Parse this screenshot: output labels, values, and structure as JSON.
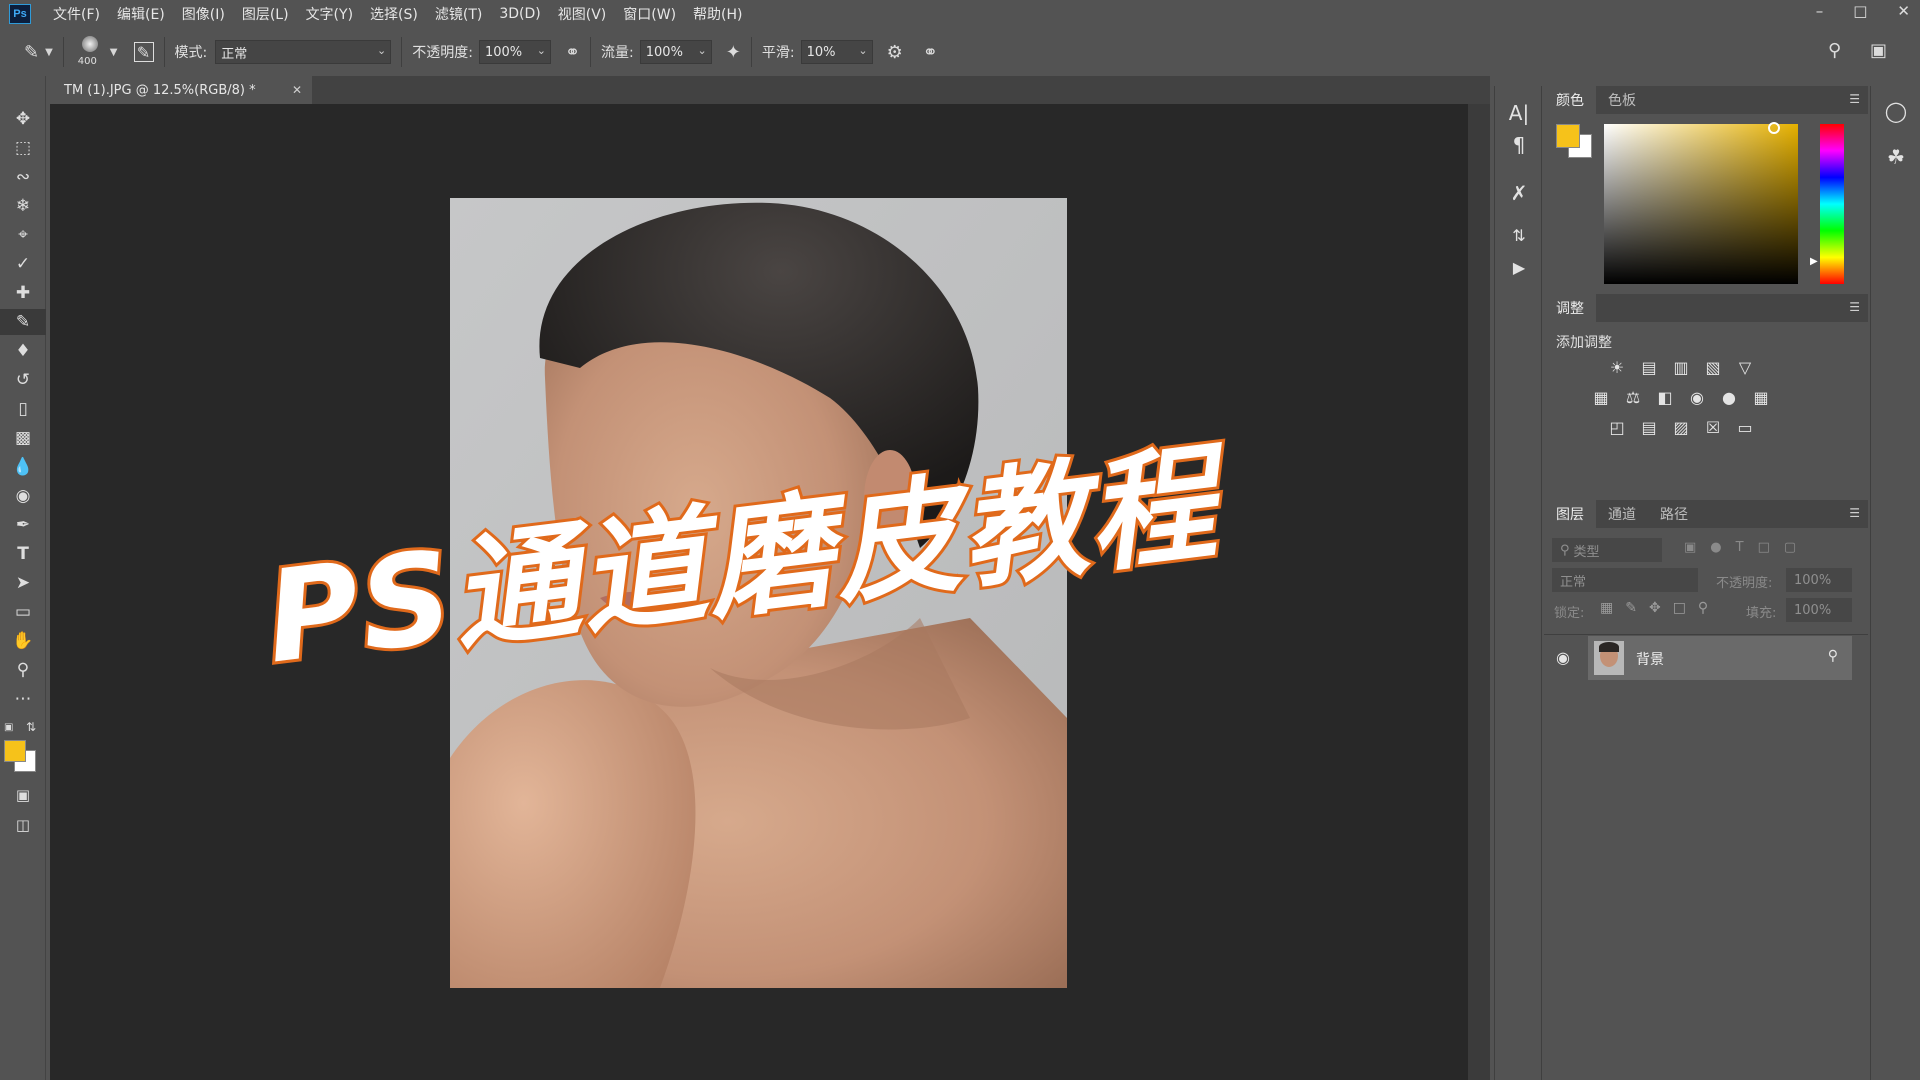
{
  "app": {
    "logo": "Ps"
  },
  "menu": [
    "文件(F)",
    "编辑(E)",
    "图像(I)",
    "图层(L)",
    "文字(Y)",
    "选择(S)",
    "滤镜(T)",
    "3D(D)",
    "视图(V)",
    "窗口(W)",
    "帮助(H)"
  ],
  "options": {
    "brush_size": "400",
    "mode_label": "模式:",
    "mode_value": "正常",
    "opacity_label": "不透明度:",
    "opacity_value": "100%",
    "flow_label": "流量:",
    "flow_value": "100%",
    "smooth_label": "平滑:",
    "smooth_value": "10%"
  },
  "document": {
    "tab_title": "TM (1).JPG @ 12.5%(RGB/8) *"
  },
  "overlay": {
    "title": "PS通道磨皮教程"
  },
  "colors": {
    "foreground": "#f6c21a",
    "background": "#ffffff",
    "overlay_stroke": "#e06a1c"
  },
  "color_panel": {
    "tabs": [
      "颜色",
      "色板"
    ]
  },
  "adjust_panel": {
    "tab": "调整",
    "heading": "添加调整"
  },
  "layers_panel": {
    "tabs": [
      "图层",
      "通道",
      "路径"
    ],
    "filter_placeholder": "类型",
    "blend_mode": "正常",
    "opacity_label": "不透明度:",
    "opacity_value": "100%",
    "lock_label": "锁定:",
    "fill_label": "填充:",
    "fill_value": "100%",
    "layers": [
      {
        "name": "背景",
        "visible": true,
        "locked": true
      }
    ]
  },
  "icons": {
    "toolbar": [
      "move-icon",
      "marquee-icon",
      "lasso-icon",
      "quick-select-icon",
      "crop-icon",
      "eyedropper-icon",
      "healing-brush-icon",
      "brush-icon",
      "stamp-icon",
      "history-brush-icon",
      "eraser-icon",
      "gradient-icon",
      "blur-icon",
      "dodge-icon",
      "pen-icon",
      "type-icon",
      "path-select-icon",
      "rectangle-icon",
      "hand-icon",
      "zoom-icon",
      "more-tools-icon"
    ]
  }
}
